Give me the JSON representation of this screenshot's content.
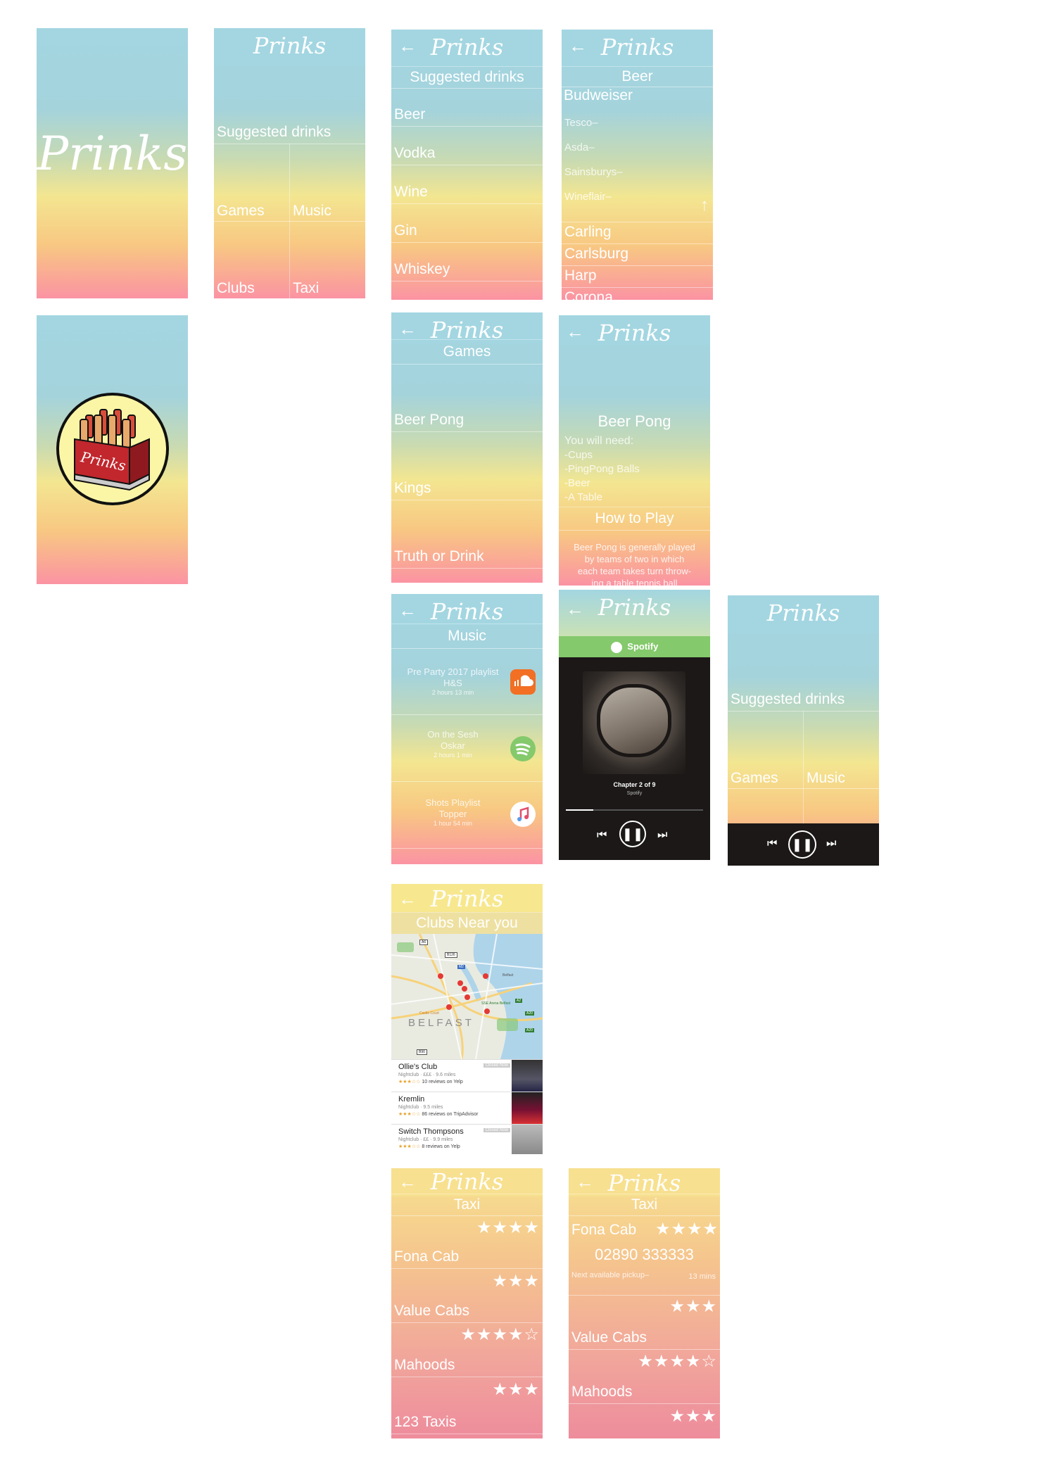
{
  "app": {
    "name": "Prinks",
    "back_icon": "arrow-left-icon",
    "scroll_up_icon": "arrow-up-icon"
  },
  "colors": {
    "sky": "#a3d6e1",
    "yellow": "#f3e691",
    "pink": "#fb93a3",
    "spotify_green": "#84c96b",
    "soundcloud_orange": "#f26f23"
  },
  "splash": {
    "logo": "Prinks"
  },
  "home": {
    "title": "Prinks",
    "suggested": "Suggested drinks",
    "games": "Games",
    "music": "Music",
    "clubs": "Clubs",
    "taxi": "Taxi"
  },
  "drinks": {
    "title": "Prinks",
    "header": "Suggested drinks",
    "items": [
      "Beer",
      "Vodka",
      "Wine",
      "Gin",
      "Whiskey"
    ]
  },
  "beer": {
    "title": "Prinks",
    "header": "Beer",
    "featured": "Budweiser",
    "stores": [
      "Tesco–",
      "Asda–",
      "Sainsburys–",
      "Wineflair–"
    ],
    "others": [
      "Carling",
      "Carlsburg",
      "Harp",
      "Corona"
    ]
  },
  "logo_screen": {
    "badge_text": "Prinks"
  },
  "games": {
    "title": "Prinks",
    "header": "Games",
    "items": [
      "Beer Pong",
      "Kings",
      "Truth or Drink"
    ]
  },
  "beerpong": {
    "title": "Prinks",
    "name": "Beer Pong",
    "need_label": "You will need:",
    "needs": [
      "-Cups",
      "-PingPong Balls",
      "-Beer",
      "-A Table"
    ],
    "howto_label": "How to Play",
    "howto_text": [
      "Beer Pong is generally played",
      "by teams of two in which",
      "each team takes turn throw-",
      "ing a table tennis ball"
    ]
  },
  "music": {
    "title": "Prinks",
    "header": "Music",
    "playlists": [
      {
        "name": "Pre Party 2017 playlist",
        "artist": "H&S",
        "duration": "2 hours 13 min",
        "icon": "soundcloud-icon"
      },
      {
        "name": "On the Sesh",
        "artist": "Oskar",
        "duration": "2 hours 1 min",
        "icon": "spotify-icon"
      },
      {
        "name": "Shots Playlist",
        "artist": "Topper",
        "duration": "1 hour 54 min",
        "icon": "apple-music-icon"
      }
    ]
  },
  "spotify": {
    "title": "Prinks",
    "brand": "Spotify",
    "track": "Chapter 2 of 9",
    "source": "Spotify",
    "progress": 0.2
  },
  "home_player": {
    "title": "Prinks",
    "suggested": "Suggested drinks",
    "games": "Games",
    "music": "Music"
  },
  "clubs": {
    "title": "Prinks",
    "header": "Clubs Near you",
    "map_labels": {
      "city": "BELFAST",
      "roads": [
        "A6",
        "B126",
        "M2",
        "A2",
        "A20",
        "A20",
        "B90"
      ],
      "place1": "Belfast",
      "place2": "SSE Arena Belfast",
      "place3": "Castle Court"
    },
    "results": [
      {
        "name": "Ollie's Club",
        "details": "Nightclub · £££ · 9.6 miles",
        "reviews": "10 reviews on Yelp",
        "stars": "★★★☆☆",
        "badge": "Closed Now"
      },
      {
        "name": "Kremlin",
        "details": "Nightclub · 9.5 miles",
        "reviews": "86 reviews on TripAdvisor",
        "stars": "★★★☆☆",
        "badge": ""
      },
      {
        "name": "Switch Thompsons",
        "details": "Nightclub · ££ · 9.9 miles",
        "reviews": "8 reviews on Yelp",
        "stars": "★★★☆☆",
        "badge": "Closed Now"
      }
    ]
  },
  "taxi": {
    "title": "Prinks",
    "header": "Taxi",
    "companies": [
      {
        "name": "Fona Cab",
        "stars": "★★★★"
      },
      {
        "name": "Value Cabs",
        "stars": "★★★"
      },
      {
        "name": "Mahoods",
        "stars": "★★★★☆"
      },
      {
        "name": "123 Taxis",
        "stars": "★★★"
      }
    ]
  },
  "taxi_detail": {
    "title": "Prinks",
    "header": "Taxi",
    "selected": {
      "name": "Fona Cab",
      "stars": "★★★★",
      "phone": "02890 333333",
      "pickup_label": "Next available pickup–",
      "pickup_time": "13 mins"
    },
    "companies": [
      {
        "name": "Value Cabs",
        "stars": "★★★"
      },
      {
        "name": "Mahoods",
        "stars": "★★★★☆"
      },
      {
        "name": "",
        "stars": "★★★"
      }
    ]
  }
}
